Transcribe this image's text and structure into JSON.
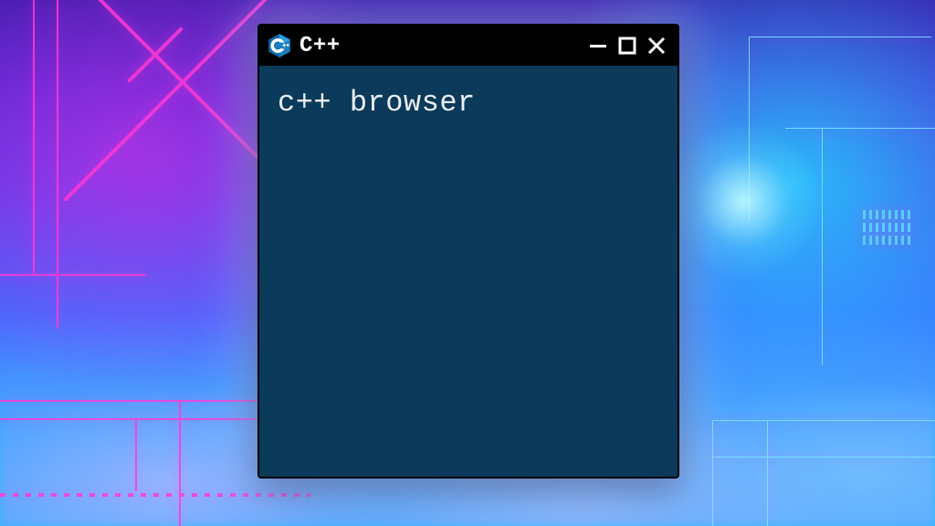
{
  "window": {
    "title": "C++",
    "icon": "cpp-hex-icon",
    "content_text": "c++ browser",
    "colors": {
      "content_bg": "#0b3a5a",
      "titlebar_bg": "#000000",
      "text": "#e9eef3",
      "icon_primary": "#0f6aa8",
      "icon_light": "#2a9fe0"
    },
    "controls": {
      "minimize": "minimize-icon",
      "maximize": "maximize-icon",
      "close": "close-icon"
    }
  }
}
